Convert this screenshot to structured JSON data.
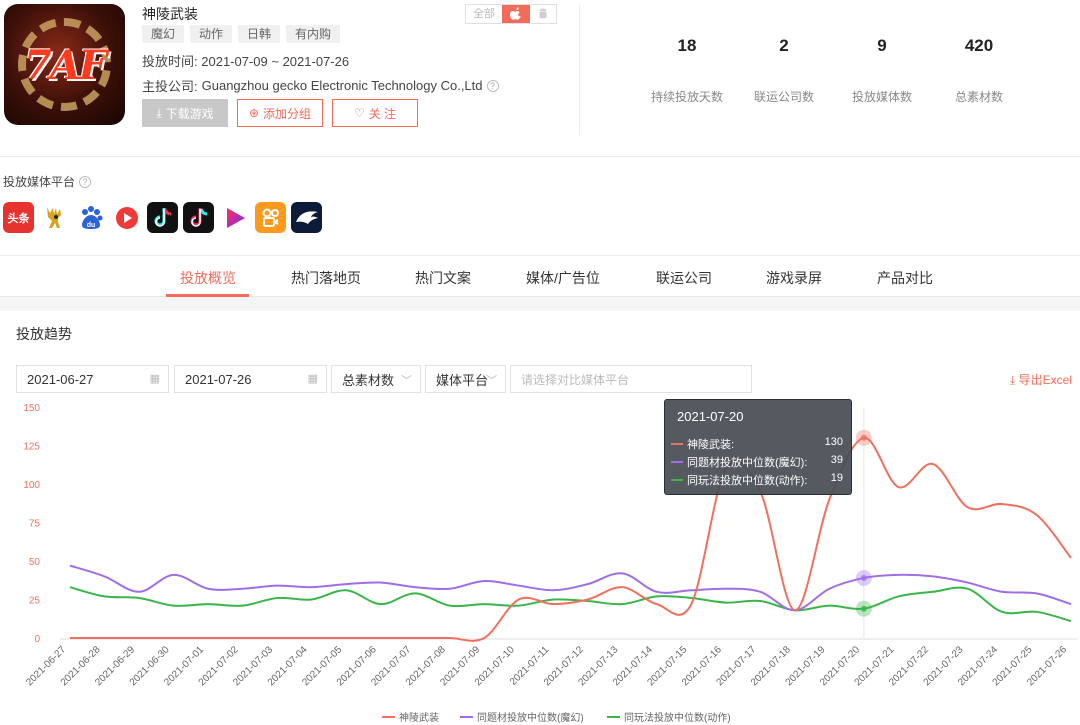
{
  "game": {
    "name": "神陵武装",
    "tags": [
      "魔幻",
      "动作",
      "日韩",
      "有内购"
    ],
    "launch_label": "投放时间:",
    "launch_range": "2021-07-09 ~ 2021-07-26",
    "publisher_label": "主投公司:",
    "publisher": "Guangzhou gecko Electronic Technology Co.,Ltd",
    "icon_text": "7AF"
  },
  "platform_switch": {
    "all": "全部",
    "ios_icon": "apple-icon",
    "android_icon": "android-icon"
  },
  "buttons": {
    "download": "下载游戏",
    "add_group": "添加分组",
    "follow": "关 注"
  },
  "stats": [
    {
      "value": "18",
      "label": "持续投放天数"
    },
    {
      "value": "2",
      "label": "联运公司数"
    },
    {
      "value": "9",
      "label": "投放媒体数"
    },
    {
      "value": "420",
      "label": "总素材数"
    }
  ],
  "media": {
    "title": "投放媒体平台",
    "platforms": [
      {
        "name": "toutiao-icon",
        "text": "头条",
        "color": "#e8322d"
      },
      {
        "name": "deer-icon",
        "text": "",
        "color": "#ffffff"
      },
      {
        "name": "baidu-icon",
        "text": "du",
        "color": "#ffffff"
      },
      {
        "name": "play-circle-icon",
        "text": "",
        "color": "#ffffff"
      },
      {
        "name": "douyin-icon",
        "text": "♪",
        "color": "#111111"
      },
      {
        "name": "douyin-alt-icon",
        "text": "♪",
        "color": "#111111"
      },
      {
        "name": "triangle-play-icon",
        "text": "",
        "color": "#ffffff"
      },
      {
        "name": "kuaishou-icon",
        "text": "",
        "color": "#ff9a1f"
      },
      {
        "name": "eagle-icon",
        "text": "",
        "color": "#0d1b3a"
      }
    ]
  },
  "tabs": [
    "投放概览",
    "热门落地页",
    "热门文案",
    "媒体/广告位",
    "联运公司",
    "游戏录屏",
    "产品对比"
  ],
  "section_title": "投放趋势",
  "filters": {
    "start_date": "2021-06-27",
    "end_date": "2021-07-26",
    "metric": "总素材数",
    "media": "媒体平台",
    "compare_placeholder": "请选择对比媒体平台",
    "export": "导出Excel"
  },
  "tooltip": {
    "date": "2021-07-20",
    "rows": [
      {
        "name": "神陵武装:",
        "value": "130",
        "color": "#f07060"
      },
      {
        "name": "同题材投放中位数(魔幻):",
        "value": "39",
        "color": "#9f6ee6"
      },
      {
        "name": "同玩法投放中位数(动作):",
        "value": "19",
        "color": "#3ab54a"
      }
    ]
  },
  "chart_data": {
    "type": "line",
    "x": [
      "2021-06-27",
      "2021-06-28",
      "2021-06-29",
      "2021-06-30",
      "2021-07-01",
      "2021-07-02",
      "2021-07-03",
      "2021-07-04",
      "2021-07-05",
      "2021-07-06",
      "2021-07-07",
      "2021-07-08",
      "2021-07-09",
      "2021-07-10",
      "2021-07-11",
      "2021-07-12",
      "2021-07-13",
      "2021-07-14",
      "2021-07-15",
      "2021-07-16",
      "2021-07-17",
      "2021-07-18",
      "2021-07-19",
      "2021-07-20",
      "2021-07-21",
      "2021-07-22",
      "2021-07-23",
      "2021-07-24",
      "2021-07-25",
      "2021-07-26"
    ],
    "ylim": [
      0,
      150
    ],
    "yticks": [
      0,
      25,
      50,
      75,
      100,
      125,
      150
    ],
    "highlight_index": 23,
    "series": [
      {
        "name": "神陵武装",
        "color": "#f07060",
        "values": [
          0,
          0,
          0,
          0,
          0,
          0,
          0,
          0,
          0,
          0,
          0,
          0,
          0,
          25,
          22,
          25,
          33,
          22,
          22,
          110,
          95,
          18,
          90,
          130,
          98,
          113,
          85,
          87,
          80,
          52
        ]
      },
      {
        "name": "同题材投放中位数(魔幻)",
        "color": "#9f6ee6",
        "values": [
          47,
          40,
          30,
          41,
          32,
          32,
          34,
          33,
          35,
          36,
          33,
          32,
          37,
          34,
          31,
          35,
          42,
          30,
          31,
          32,
          30,
          18,
          32,
          39,
          41,
          40,
          36,
          30,
          29,
          22
        ]
      },
      {
        "name": "同玩法投放中位数(动作)",
        "color": "#3ab54a",
        "values": [
          33,
          27,
          26,
          21,
          22,
          21,
          26,
          25,
          31,
          22,
          29,
          21,
          22,
          21,
          25,
          24,
          22,
          27,
          26,
          23,
          24,
          18,
          21,
          19,
          27,
          30,
          32,
          17,
          17,
          11
        ]
      }
    ]
  }
}
